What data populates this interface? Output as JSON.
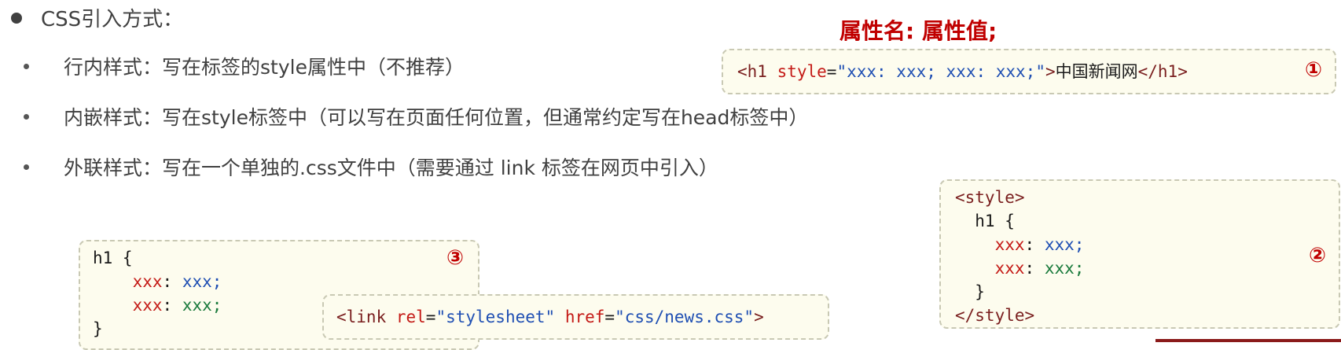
{
  "heading": "CSS引入方式：",
  "items": [
    {
      "label": "行内样式：",
      "text": "写在标签的style属性中（不推荐）"
    },
    {
      "label": "内嵌样式：",
      "text": "写在style标签中（可以写在页面任何位置，但通常约定写在head标签中）"
    },
    {
      "label": "外联样式：",
      "text": "写在一个单独的.css文件中（需要通过 link 标签在网页中引入）"
    }
  ],
  "annotation": "属性名: 属性值;",
  "box1": {
    "number": "①",
    "open_tag": "<h1 ",
    "attr": "style",
    "eq": "=",
    "value": "\"xxx: xxx; xxx: xxx;\"",
    "close_bracket": ">",
    "content": "中国新闻网",
    "end_tag": "</h1>"
  },
  "box2": {
    "number": "②",
    "open": "<style>",
    "selector": "  h1 {",
    "prop1": "xxx",
    "val1": "xxx;",
    "prop2": "xxx",
    "val2": "xxx;",
    "close_brace": "  }",
    "close": "</style>"
  },
  "box3": {
    "number": "③",
    "selector": "h1 {",
    "prop1": "xxx",
    "val1": "xxx;",
    "prop2": "xxx",
    "val2": "xxx;",
    "close_brace": "}"
  },
  "box4": {
    "open": "<link ",
    "rel_attr": "rel",
    "rel_val": "\"stylesheet\"",
    "href_attr": "href",
    "href_val": "\"css/news.css\"",
    "close": ">"
  },
  "colors": {
    "accent": "#c00000",
    "box_bg": "#fdfcee",
    "value_blue": "#1f4fb3",
    "value_green": "#1a7a3c"
  }
}
